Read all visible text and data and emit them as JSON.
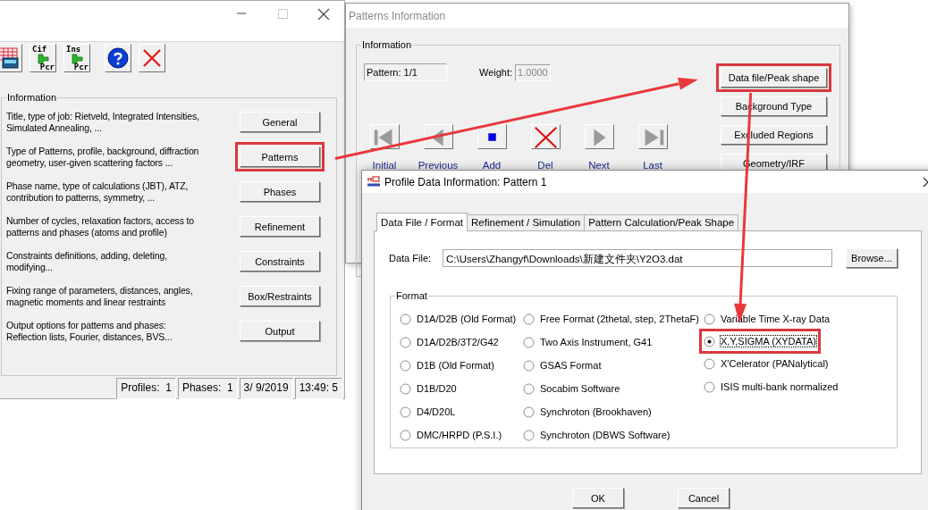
{
  "main_window": {
    "controls": [
      {
        "kind": "minimize",
        "disabled": false
      },
      {
        "kind": "maximize",
        "disabled": true
      },
      {
        "kind": "close",
        "disabled": false
      }
    ],
    "toolbar": [
      {
        "kind": "grid"
      },
      {
        "kind": "convert",
        "top": "Cif",
        "bottom": "Pcr"
      },
      {
        "kind": "convert",
        "top": "Ins",
        "bottom": "Pcr"
      },
      {
        "kind": "help"
      },
      {
        "kind": "close"
      }
    ],
    "information": {
      "legend": "Information",
      "rows": [
        {
          "description": "Title, type of job: Rietveld, Integrated Intensities,\n Simulated Annealing, ...",
          "button": "General",
          "highlighted": false
        },
        {
          "description": "Type of Patterns, profile, background, diffraction\ngeometry, user-given scattering factors ...",
          "button": "Patterns",
          "highlighted": true
        },
        {
          "description": "Phase name, type of calculations (JBT),  ATZ,\ncontribution to patterns, symmetry, ...",
          "button": "Phases",
          "highlighted": false
        },
        {
          "description": "Number of cycles, relaxation factors, access to\npatterns and phases (atoms and profile)",
          "button": "Refinement",
          "highlighted": false
        },
        {
          "description": "Constraints definitions, adding, deleting,\nmodifying...",
          "button": "Constraints",
          "highlighted": false
        },
        {
          "description": "Fixing range of parameters, distances, angles,\nmagnetic moments and linear restraints",
          "button": "Box/Restraints",
          "highlighted": false
        },
        {
          "description": "Output options for patterns and phases:\nReflection lists, Fourier, distances, BVS...",
          "button": "Output",
          "highlighted": false
        }
      ]
    },
    "status_bar": [
      "Profiles:  1",
      "Phases:  1",
      "3/ 9/2019",
      "13:49: 5"
    ]
  },
  "patterns_window": {
    "title": "Patterns Information",
    "active": false,
    "information": {
      "legend": "Information",
      "pattern": "Pattern: 1/1",
      "weight_label": "Weight:",
      "weight": {
        "value": "1.0000",
        "disabled": true
      },
      "nav": [
        {
          "kind": "first",
          "label": "Initial",
          "disabled": true
        },
        {
          "kind": "previous",
          "label": "Previous",
          "disabled": true
        },
        {
          "kind": "add",
          "label": "Add",
          "disabled": false
        },
        {
          "kind": "delete",
          "label": "Del",
          "disabled": false
        },
        {
          "kind": "next",
          "label": "Next",
          "disabled": true
        },
        {
          "kind": "last",
          "label": "Last",
          "disabled": true
        }
      ],
      "buttons": [
        {
          "label": "Data file/Peak shape",
          "highlighted": true
        },
        {
          "label": "Background Type",
          "highlighted": false
        },
        {
          "label": "Excluded Regions",
          "highlighted": false
        },
        {
          "label": "Geometry/IRF",
          "highlighted": false
        }
      ]
    }
  },
  "profile_dialog": {
    "title": "Profile Data Information: Pattern 1",
    "active": true,
    "tabs": [
      {
        "label": "Data File / Format",
        "selected": true
      },
      {
        "label": "Refinement / Simulation",
        "selected": false
      },
      {
        "label": "Pattern Calculation/Peak Shape",
        "selected": false
      }
    ],
    "data_file": {
      "label": "Data File:",
      "value": "C:\\Users\\Zhangyf\\Downloads\\新建文件夹\\Y2O3.dat",
      "browse": "Browse..."
    },
    "format": {
      "legend": "Format",
      "columns": [
        [
          {
            "label": "D1A/D2B (Old Format)",
            "selected": false,
            "highlighted": false
          },
          {
            "label": "D1A/D2B/3T2/G42",
            "selected": false,
            "highlighted": false
          },
          {
            "label": "D1B (Old Format)",
            "selected": false,
            "highlighted": false
          },
          {
            "label": "D1B/D20",
            "selected": false,
            "highlighted": false
          },
          {
            "label": "D4/D20L",
            "selected": false,
            "highlighted": false
          },
          {
            "label": "DMC/HRPD (P.S.I.)",
            "selected": false,
            "highlighted": false
          }
        ],
        [
          {
            "label": "Free Format (2thetal, step, 2ThetaF)",
            "selected": false,
            "highlighted": false
          },
          {
            "label": "Two Axis Instrument, G41",
            "selected": false,
            "highlighted": false
          },
          {
            "label": "GSAS Format",
            "selected": false,
            "highlighted": false
          },
          {
            "label": "Socabim Software",
            "selected": false,
            "highlighted": false
          },
          {
            "label": "Synchroton (Brookhaven)",
            "selected": false,
            "highlighted": false
          },
          {
            "label": "Synchroton (DBWS Software)",
            "selected": false,
            "highlighted": false
          }
        ],
        [
          {
            "label": "Variable Time X-ray Data",
            "selected": false,
            "highlighted": false
          },
          {
            "label": "X,Y,SIGMA (XYDATA)",
            "selected": true,
            "highlighted": true
          },
          {
            "label": "X'Celerator (PANalytical)",
            "selected": false,
            "highlighted": false
          },
          {
            "label": "ISIS multi-bank normalized",
            "selected": false,
            "highlighted": false
          }
        ]
      ]
    },
    "buttons": [
      "OK",
      "Cancel"
    ]
  }
}
